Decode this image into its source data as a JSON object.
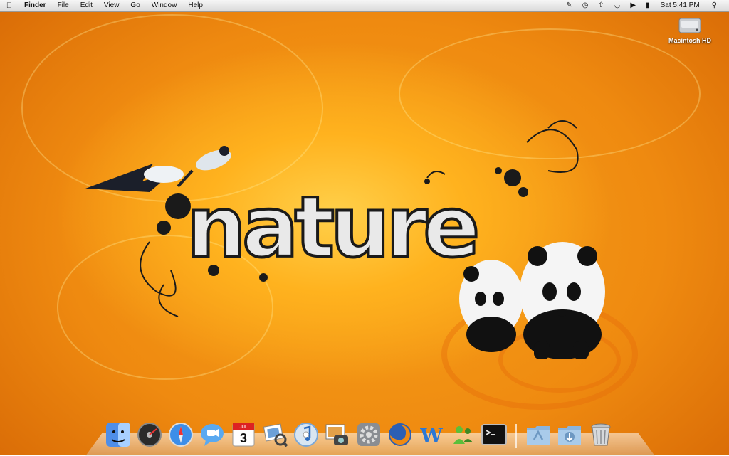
{
  "menubar": {
    "apple_icon": "apple-icon",
    "app_name": "Finder",
    "menus": [
      "File",
      "Edit",
      "View",
      "Go",
      "Window",
      "Help"
    ],
    "status_icons": [
      "script-icon",
      "time-machine-icon",
      "bluetooth-icon",
      "wifi-icon",
      "volume-icon",
      "battery-icon"
    ],
    "clock": "Sat 5:41 PM",
    "spotlight_icon": "spotlight-search-icon"
  },
  "desktop": {
    "wallpaper_text": "nature",
    "hd_label": "Macintosh HD"
  },
  "dock": {
    "calendar_month": "JUL",
    "calendar_day": "3",
    "apps": [
      "finder-icon",
      "dashboard-icon",
      "safari-icon",
      "ichat-icon",
      "ical-icon",
      "preview-icon",
      "itunes-icon",
      "iphoto-icon",
      "system-preferences-icon",
      "firefox-icon",
      "wordpress-icon",
      "microsoft-messenger-icon",
      "terminal-icon"
    ],
    "stacks": [
      "applications-folder-icon",
      "downloads-folder-icon",
      "trash-icon"
    ]
  },
  "colors": {
    "wallpaper": "#f39a18",
    "accent": "#ffd04a"
  }
}
